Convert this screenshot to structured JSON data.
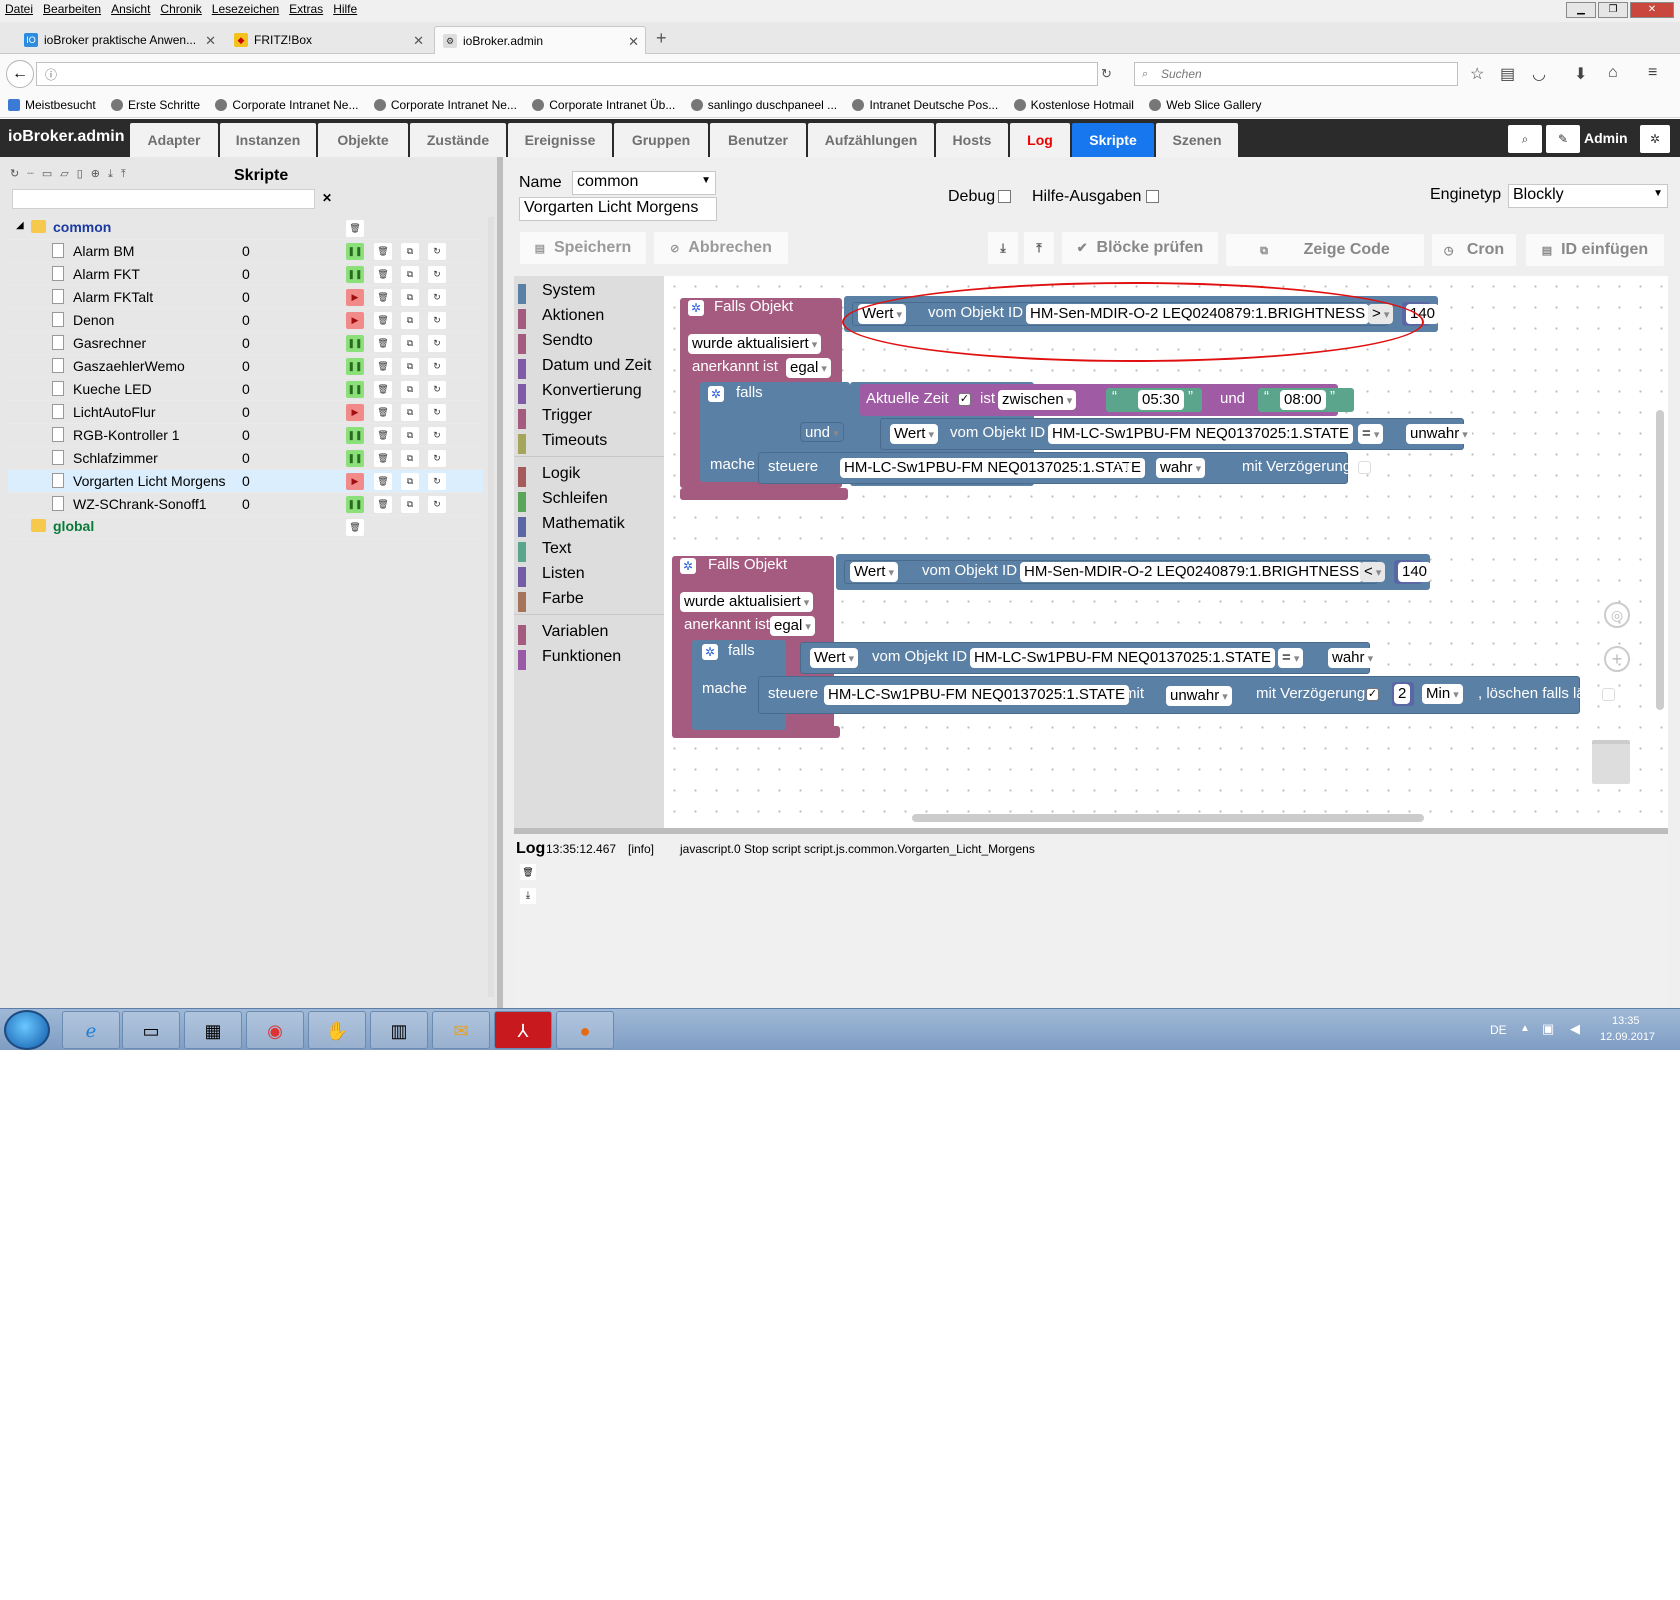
{
  "browser": {
    "menu": [
      "Datei",
      "Bearbeiten",
      "Ansicht",
      "Chronik",
      "Lesezeichen",
      "Extras",
      "Hilfe"
    ],
    "tabs": [
      {
        "label": "ioBroker praktische Anwen..."
      },
      {
        "label": "FRITZ!Box"
      },
      {
        "label": "ioBroker.admin"
      }
    ],
    "search_placeholder": "Suchen",
    "bookmarks": [
      "Meistbesucht",
      "Erste Schritte",
      "Corporate Intranet Ne...",
      "Corporate Intranet Ne...",
      "Corporate Intranet Üb...",
      "sanlingo duschpaneel ...",
      "Intranet Deutsche Pos...",
      "Kostenlose Hotmail",
      "Web Slice Gallery"
    ]
  },
  "app": {
    "title": "ioBroker.admin",
    "tabs": [
      "Adapter",
      "Instanzen",
      "Objekte",
      "Zustände",
      "Ereignisse",
      "Gruppen",
      "Benutzer",
      "Aufzählungen",
      "Hosts",
      "Log",
      "Skripte",
      "Szenen"
    ],
    "user": "Admin"
  },
  "scripts": {
    "header": "Skripte",
    "folders": {
      "common": "common",
      "global": "global"
    },
    "items": [
      {
        "name": "Alarm BM",
        "count": "0"
      },
      {
        "name": "Alarm FKT",
        "count": "0"
      },
      {
        "name": "Alarm FKTalt",
        "count": "0"
      },
      {
        "name": "Denon",
        "count": "0"
      },
      {
        "name": "Gasrechner",
        "count": "0"
      },
      {
        "name": "GaszaehlerWemo",
        "count": "0"
      },
      {
        "name": "Kueche LED",
        "count": "0"
      },
      {
        "name": "LichtAutoFlur",
        "count": "0"
      },
      {
        "name": "RGB-Kontroller 1",
        "count": "0"
      },
      {
        "name": "Schlafzimmer",
        "count": "0"
      },
      {
        "name": "Vorgarten Licht Morgens",
        "count": "0"
      },
      {
        "name": "WZ-SChrank-Sonoff1",
        "count": "0"
      }
    ]
  },
  "editor": {
    "name_label": "Name",
    "folder_value": "common",
    "script_name": "Vorgarten Licht Morgens",
    "debug_label": "Debug",
    "help_label": "Hilfe-Ausgaben",
    "engine_label": "Enginetyp",
    "engine_value": "Blockly",
    "buttons": {
      "save": "Speichern",
      "cancel": "Abbrechen",
      "check": "Blöcke prüfen",
      "show_code": "Zeige Code",
      "cron": "Cron",
      "insert_id": "ID einfügen"
    }
  },
  "toolbox": {
    "categories": [
      {
        "label": "System",
        "color": "#5b80a5"
      },
      {
        "label": "Aktionen",
        "color": "#a55b80"
      },
      {
        "label": "Sendto",
        "color": "#a55b80"
      },
      {
        "label": "Datum und Zeit",
        "color": "#7f5ba5"
      },
      {
        "label": "Konvertierung",
        "color": "#7f5ba5"
      },
      {
        "label": "Trigger",
        "color": "#a55b80"
      },
      {
        "label": "Timeouts",
        "color": "#a5a55b"
      },
      {
        "label": "Logik",
        "color": "#a55b5b"
      },
      {
        "label": "Schleifen",
        "color": "#5ba55b"
      },
      {
        "label": "Mathematik",
        "color": "#5b67a5"
      },
      {
        "label": "Text",
        "color": "#5ba58c"
      },
      {
        "label": "Listen",
        "color": "#745ba5"
      },
      {
        "label": "Farbe",
        "color": "#a5745b"
      },
      {
        "label": "Variablen",
        "color": "#a55b80"
      },
      {
        "label": "Funktionen",
        "color": "#995ba5"
      }
    ]
  },
  "blocks": {
    "b1": {
      "trigger": "Falls Objekt",
      "value_field": "Wert",
      "from_id": "vom Objekt ID",
      "object_id": "HM-Sen-MDIR-O-2 LEQ0240879:1.BRIGHTNESS",
      "op": ">",
      "threshold": "140",
      "updated": "wurde aktualisiert",
      "ack_label": "anerkannt ist",
      "ack_value": "egal",
      "if_label": "falls",
      "do_label": "mache",
      "time_label": "Aktuelle Zeit",
      "is_label": "ist",
      "between": "zwischen",
      "t1": "05:30",
      "and_label": "und",
      "t2": "08:00",
      "and_op": "und",
      "cond_value": "Wert",
      "cond_from": "vom Objekt ID",
      "cond_id": "HM-LC-Sw1PBU-FM NEQ0137025:1.STATE",
      "cond_op": "=",
      "cond_val": "unwahr",
      "set_label": "steuere",
      "set_id": "HM-LC-Sw1PBU-FM NEQ0137025:1.STATE",
      "with_label": "mit",
      "set_val": "wahr",
      "delay_label": "mit Verzögerung"
    },
    "b2": {
      "trigger": "Falls Objekt",
      "value_field": "Wert",
      "from_id": "vom Objekt ID",
      "object_id": "HM-Sen-MDIR-O-2 LEQ0240879:1.BRIGHTNESS",
      "op": "<",
      "threshold": "140",
      "updated": "wurde aktualisiert",
      "ack_label": "anerkannt ist",
      "ack_value": "egal",
      "if_label": "falls",
      "do_label": "mache",
      "cond_value": "Wert",
      "cond_from": "vom Objekt ID",
      "cond_id": "HM-LC-Sw1PBU-FM NEQ0137025:1.STATE",
      "cond_op": "=",
      "cond_val": "wahr",
      "set_label": "steuere",
      "set_id": "HM-LC-Sw1PBU-FM NEQ0137025:1.STATE",
      "with_label": "mit",
      "set_val": "unwahr",
      "delay_label": "mit Verzögerung",
      "delay_num": "2",
      "delay_unit": "Min",
      "clear_label": ", löschen falls läuft"
    }
  },
  "log": {
    "label": "Log",
    "time": "13:35:12.467",
    "level": "[info]",
    "message": "javascript.0 Stop script script.js.common.Vorgarten_Licht_Morgens"
  },
  "taskbar": {
    "lang": "DE",
    "time": "13:35",
    "date": "12.09.2017"
  }
}
